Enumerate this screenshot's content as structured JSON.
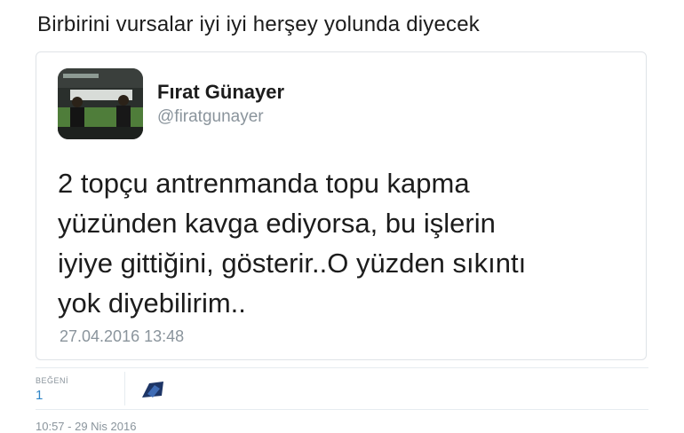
{
  "tweet": {
    "text": "Birbirini vursalar iyi iyi herşey yolunda diyecek",
    "timestamp": "10:57 - 29 Nis 2016"
  },
  "quoted_tweet": {
    "display_name": "Fırat Günayer",
    "handle": "@firatgunayer",
    "text": "2 topçu antrenmanda topu kapma\nyüzünden kavga ediyorsa, bu işlerin\niyiye gittiğini, gösterir..O yüzden sıkıntı\nyok diyebilirim..",
    "timestamp": "27.04.2016 13:48",
    "avatar_icon": "profile-photo"
  },
  "stats": {
    "likes_label": "BEĞENİ",
    "likes_count": "1"
  },
  "colors": {
    "link_blue": "#2f85c7",
    "muted_gray": "#8a949c",
    "border": "#dfe3e7"
  }
}
